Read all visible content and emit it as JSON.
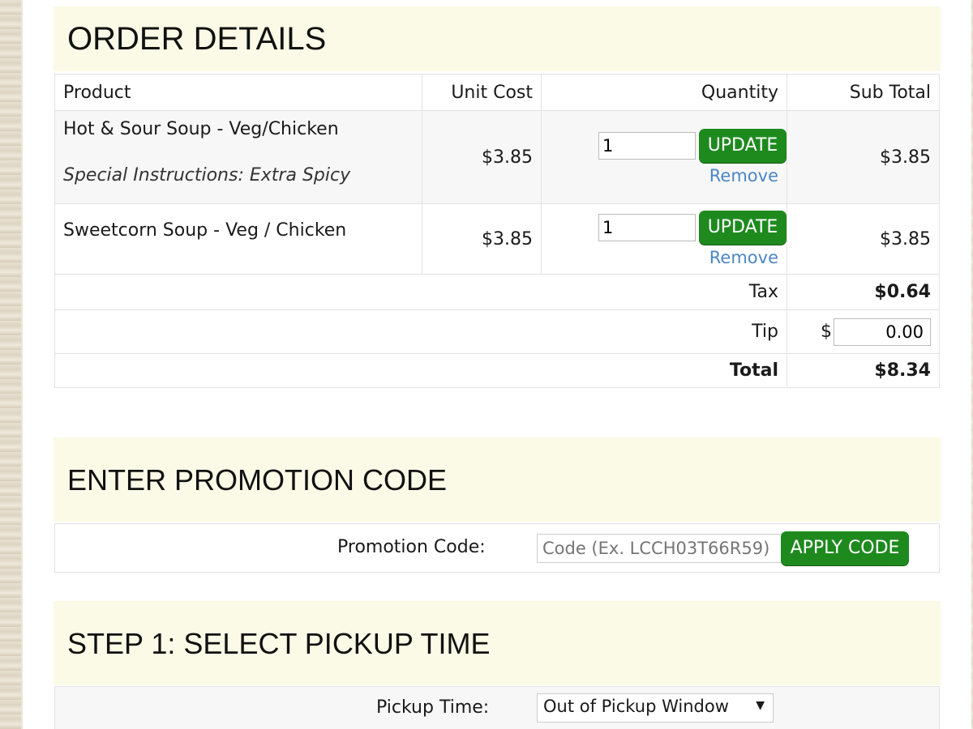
{
  "order": {
    "title": "ORDER DETAILS",
    "columns": {
      "product": "Product",
      "unit_cost": "Unit Cost",
      "quantity": "Quantity",
      "sub_total": "Sub Total"
    },
    "items": [
      {
        "name": "Hot & Sour Soup - Veg/Chicken",
        "special": "Special Instructions: Extra Spicy",
        "unit_cost": "$3.85",
        "quantity": "1",
        "update_label": "UPDATE",
        "remove_label": "Remove",
        "sub_total": "$3.85"
      },
      {
        "name": "Sweetcorn Soup - Veg / Chicken",
        "special": "",
        "unit_cost": "$3.85",
        "quantity": "1",
        "update_label": "UPDATE",
        "remove_label": "Remove",
        "sub_total": "$3.85"
      }
    ],
    "tax_label": "Tax",
    "tax_value": "$0.64",
    "tip_label": "Tip",
    "tip_currency": "$",
    "tip_value": "0.00",
    "total_label": "Total",
    "total_value": "$8.34"
  },
  "promo": {
    "title": "ENTER PROMOTION CODE",
    "label": "Promotion Code:",
    "placeholder": "Code (Ex. LCCH03T66R59)",
    "button": "APPLY CODE"
  },
  "pickup": {
    "title": "STEP 1: SELECT PICKUP TIME",
    "label": "Pickup Time:",
    "selected": "Out of Pickup Window"
  },
  "colors": {
    "accent_green": "#1e8a1e",
    "link_blue": "#4c86c6",
    "section_bg": "#fafae6"
  }
}
